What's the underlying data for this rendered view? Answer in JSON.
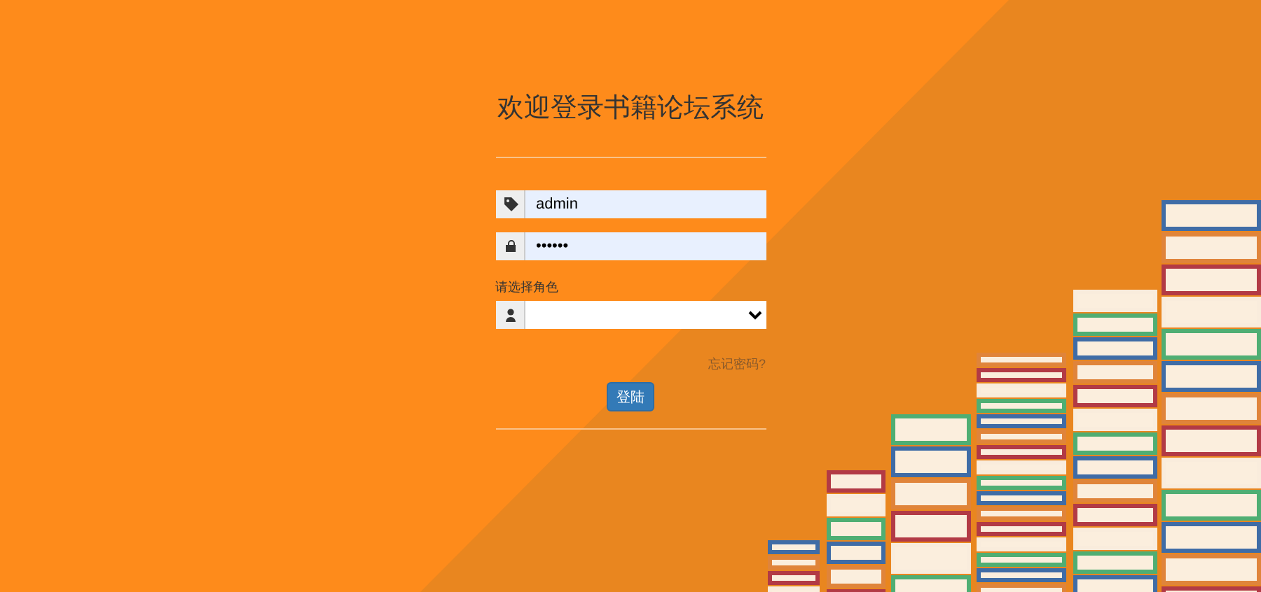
{
  "title": "欢迎登录书籍论坛系统",
  "fields": [
    {
      "kind": "text",
      "value": "admin"
    },
    {
      "kind": "password",
      "value": "••••••"
    }
  ],
  "role": {
    "label": "请选择角色"
  },
  "forgot_link": "忘记密码?",
  "login_button": "登陆"
}
